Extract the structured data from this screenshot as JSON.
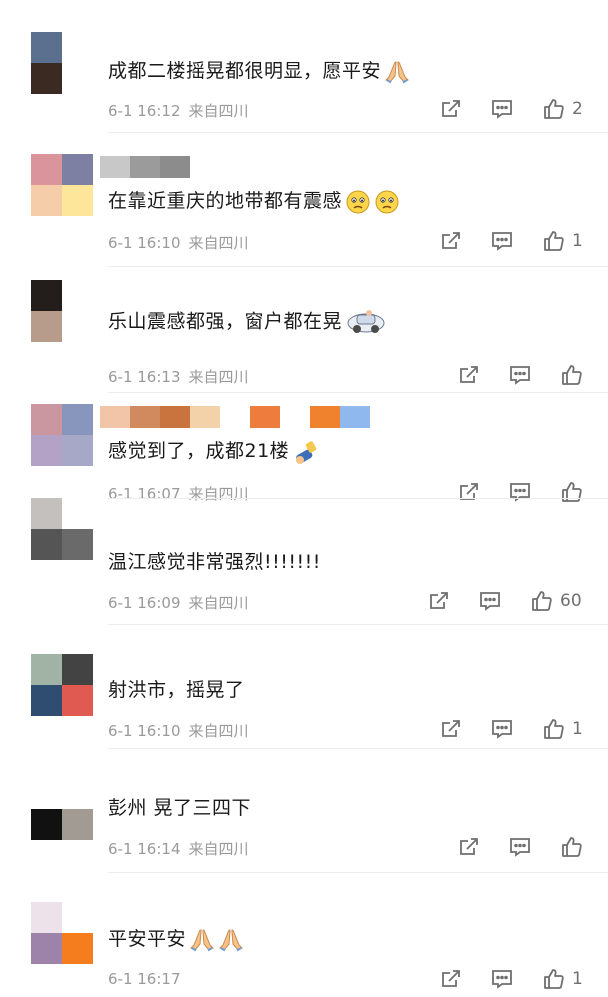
{
  "comments": [
    {
      "text": "成都二楼摇晃都很明显，愿平安",
      "emoji": [
        "pray"
      ],
      "time": "6-1 16:12",
      "location": "来自四川",
      "likes": "2",
      "avatar_colors": [
        "#5b6f8e",
        "#ffffff",
        "#3b2a22",
        "#ffffff"
      ],
      "name_blocks": []
    },
    {
      "text": "在靠近重庆的地带都有震感",
      "emoji": [
        "sad",
        "sad"
      ],
      "time": "6-1 16:10",
      "location": "来自四川",
      "likes": "1",
      "avatar_colors": [
        "#d9959b",
        "#7d7fa3",
        "#f5cda9",
        "#fde59a"
      ],
      "name_blocks": [
        "#c8c8c8",
        "#9b9b9b",
        "#8c8c8c"
      ]
    },
    {
      "text": "乐山震感都强，窗户都在晃",
      "emoji": [
        "car"
      ],
      "time": "6-1 16:13",
      "location": "来自四川",
      "likes": "",
      "avatar_colors": [
        "#231d1c",
        "#ffffff",
        "#b79c8c",
        "#ffffff"
      ],
      "name_blocks": []
    },
    {
      "text": "感觉到了，成都21楼",
      "emoji": [
        "cheer"
      ],
      "time": "6-1 16:07",
      "location": "来自四川",
      "likes": "",
      "avatar_colors": [
        "#ca96a0",
        "#8896be",
        "#b4a1c6",
        "#a7a7c7"
      ],
      "name_blocks": [
        "#f2c4a8",
        "#d18a5e",
        "#c9743f",
        "#f3d1a9",
        "#ffffff",
        "#ee7c3c",
        "#ffffff",
        "#f0822e",
        "#8fb8ef"
      ]
    },
    {
      "text": "温江感觉非常强烈!!!!!!!",
      "emoji": [],
      "time": "6-1 16:09",
      "location": "来自四川",
      "likes": "60",
      "avatar_colors": [
        "#c4c0bd",
        "#ffffff",
        "#555555",
        "#6a6a6a"
      ],
      "name_blocks": []
    },
    {
      "text": "射洪市，摇晃了",
      "emoji": [],
      "time": "6-1 16:10",
      "location": "来自四川",
      "likes": "1",
      "avatar_colors": [
        "#a0b3a4",
        "#434343",
        "#2f4d70",
        "#e05a52"
      ],
      "name_blocks": []
    },
    {
      "text": "彭州 晃了三四下",
      "emoji": [],
      "time": "6-1 16:14",
      "location": "来自四川",
      "likes": "",
      "avatar_colors": [
        "#ffffff",
        "#ffffff",
        "#111111",
        "#a19b93"
      ],
      "name_blocks": []
    },
    {
      "text": "平安平安",
      "emoji": [
        "pray",
        "pray"
      ],
      "time": "6-1 16:17",
      "location": "",
      "likes": "1",
      "avatar_colors": [
        "#ede1ea",
        "#ffffff",
        "#9d82a9",
        "#f57d1e"
      ],
      "name_blocks": []
    }
  ],
  "icons": {
    "repost": "repost-icon",
    "comment": "comment-icon",
    "like": "like-icon"
  },
  "colors": {
    "text": "#1a1a1a",
    "meta": "#9a9a9a",
    "icon": "#6f6f6f"
  }
}
